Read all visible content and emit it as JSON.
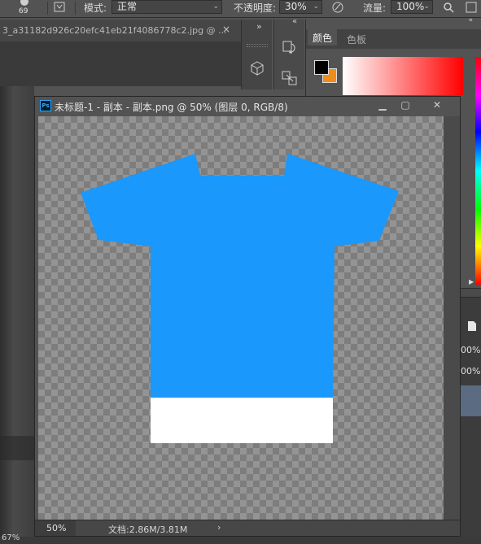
{
  "options_bar": {
    "brush_size": "69",
    "mode_label": "模式:",
    "mode_value": "正常",
    "opacity_label": "不透明度:",
    "opacity_value": "30%",
    "flow_label": "流量:",
    "flow_value": "100%"
  },
  "background_tab": {
    "title": "3_a31182d926c20efc41eb21f4086778c2.jpg @ ...",
    "close": "×"
  },
  "panel_collapse": "«",
  "strip_collapse": "»",
  "color_panel": {
    "tab_color": "颜色",
    "tab_swatches": "色板",
    "foreground_color": "#000000",
    "background_color": "#ef8c1a"
  },
  "right_column": {
    "values": [
      "00%",
      "00%"
    ]
  },
  "document": {
    "title": "未标题-1 - 副本 - 副本.png @ 50% (图层 0, RGB/8)",
    "zoom": "50%",
    "doc_size": "文档:2.86M/3.81M",
    "status_arrow": "›"
  },
  "artwork": {
    "shirt_color": "#1a98fc",
    "hem_color": "#ffffff"
  },
  "bottom": {
    "zoom_fragment": "67%"
  }
}
